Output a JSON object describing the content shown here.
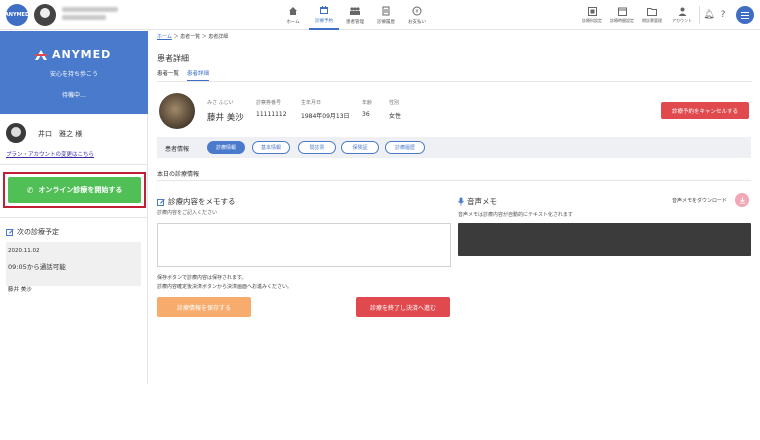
{
  "topbar": {
    "logo_text": "ANYMED",
    "nav": [
      {
        "label": "ホーム",
        "icon": "home-icon"
      },
      {
        "label": "診療予約",
        "icon": "calendar-icon",
        "active": true
      },
      {
        "label": "患者管理",
        "icon": "people-icon"
      },
      {
        "label": "診療履歴",
        "icon": "document-icon"
      },
      {
        "label": "お支払い",
        "icon": "payment-icon"
      }
    ],
    "right_nav": [
      {
        "label": "診療科設定",
        "icon": "grid-icon"
      },
      {
        "label": "診療時間設定",
        "icon": "clock-calendar-icon"
      },
      {
        "label": "問診票管理",
        "icon": "folder-icon"
      },
      {
        "label": "アカウント",
        "icon": "person-icon"
      }
    ]
  },
  "sidebar": {
    "brand_name": "ANYMED",
    "tagline": "安心を持ち歩こう",
    "status": "待機中…",
    "doctor_name": "井口　雅之 様",
    "plan_link": "プラン・アカウントの変更はこちら",
    "start_button": "オンライン診療を開始する",
    "next_title": "次の診療予定",
    "appointment": {
      "date": "2020.11.02",
      "time": "09:05から通話可能",
      "patient": "藤井 美沙"
    }
  },
  "main": {
    "breadcrumb": {
      "home": "ホーム",
      "sep1": "＞",
      "list": "患者一覧",
      "sep2": "＞",
      "current": "患者詳細"
    },
    "title": "患者詳細",
    "subtabs": [
      {
        "label": "患者一覧"
      },
      {
        "label": "患者詳細",
        "active": true
      }
    ],
    "patient": {
      "kana": "みさ ふじい",
      "name": "藤井 美沙",
      "number_label": "診察券番号",
      "number": "11111112",
      "birth_label": "生年月日",
      "birth": "1984年09月13日",
      "age_label": "年齢",
      "age": "36",
      "sex_label": "性別",
      "sex": "女性"
    },
    "cancel_button": "診療予約をキャンセルする",
    "info_label": "患者情報",
    "info_tabs": [
      {
        "label": "診療情報",
        "active": true
      },
      {
        "label": "基本情報"
      },
      {
        "label": "問診票"
      },
      {
        "label": "保険証"
      },
      {
        "label": "診療履歴"
      }
    ],
    "today_title": "本日の診療情報",
    "memo": {
      "title": "診療内容をメモする",
      "subtitle": "診療内容をご記入ください",
      "value": "",
      "note1": "保存ボタンで診療内容は保存されます。",
      "note2": "診療内容確定後決済ボタンから決済画面へお進みください。",
      "save_button": "診療情報を保存する",
      "finish_button": "診療を終了し決済へ進む"
    },
    "voice": {
      "title": "音声メモ",
      "download": "音声メモをダウンロード",
      "subtitle": "音声メモは診療内容が自動的にテキスト化されます"
    }
  },
  "colors": {
    "brand_blue": "#4a7acb",
    "start_green": "#4fbf56",
    "danger_red": "#e04a4e",
    "save_orange": "#f7ac6e",
    "highlight_frame": "#c21e35"
  }
}
